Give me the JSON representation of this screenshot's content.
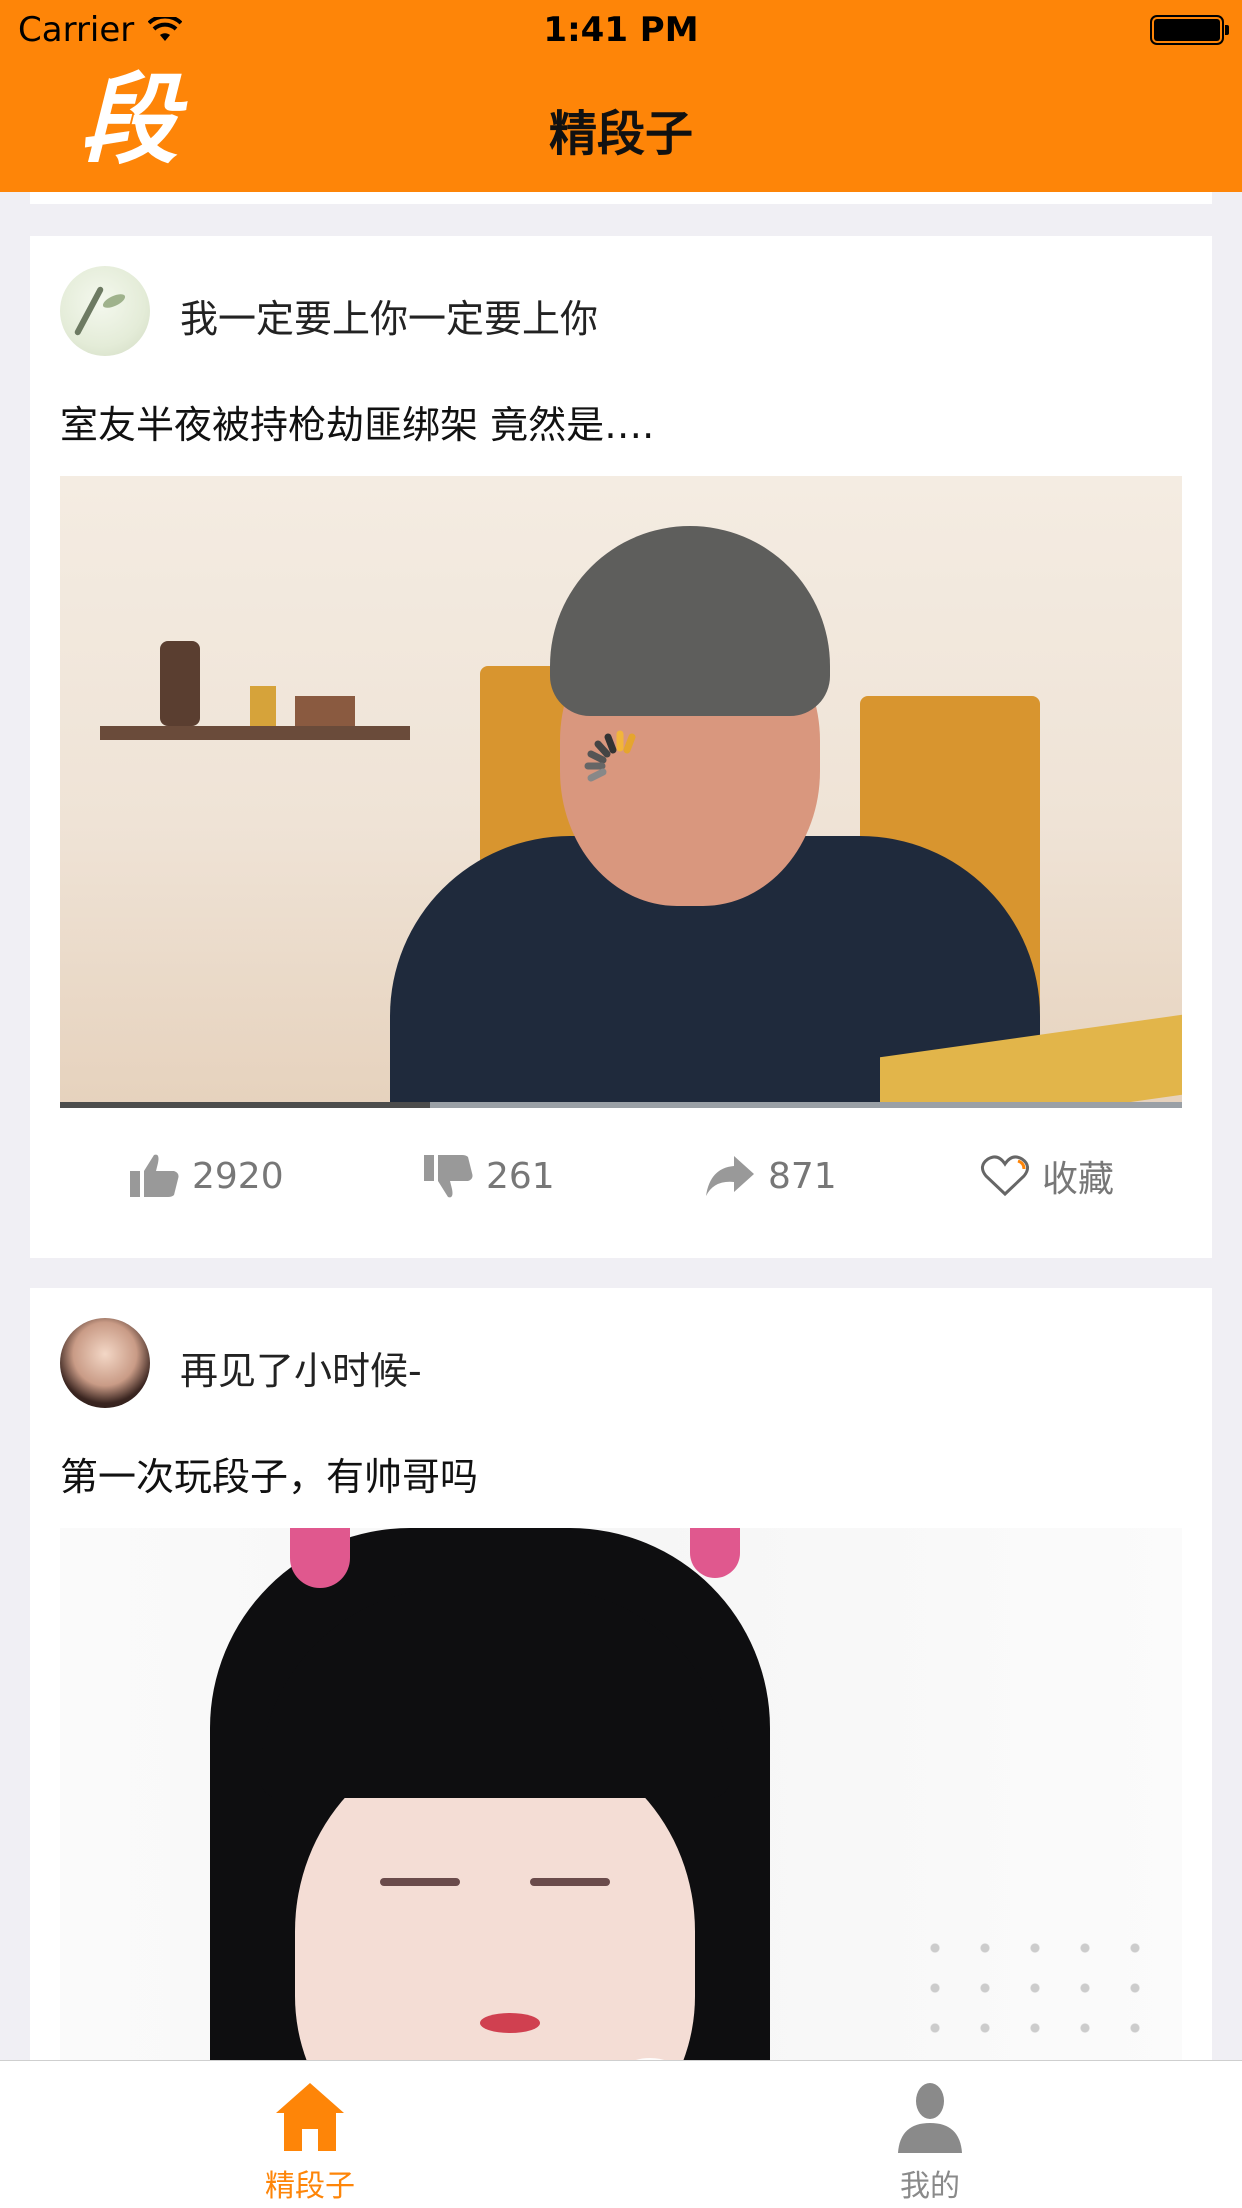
{
  "status_bar": {
    "carrier": "Carrier",
    "time": "1:41 PM"
  },
  "nav": {
    "logo": "段",
    "title": "精段子"
  },
  "posts": [
    {
      "username": "我一定要上你一定要上你",
      "text": "室友半夜被持枪劫匪绑架 竟然是….",
      "media_type": "video",
      "video_progress": 0.33,
      "likes": "2920",
      "dislikes": "261",
      "shares": "871",
      "favorite_label": "收藏"
    },
    {
      "username": "再见了小时候-",
      "text": "第一次玩段子，有帅哥吗",
      "media_type": "video"
    }
  ],
  "tabbar": {
    "items": [
      {
        "label": "精段子",
        "icon": "home-icon",
        "active": true
      },
      {
        "label": "我的",
        "icon": "person-icon",
        "active": false
      }
    ]
  },
  "colors": {
    "accent": "#fe8508",
    "background": "#f0eff4",
    "inactive": "#8a8a8a"
  }
}
